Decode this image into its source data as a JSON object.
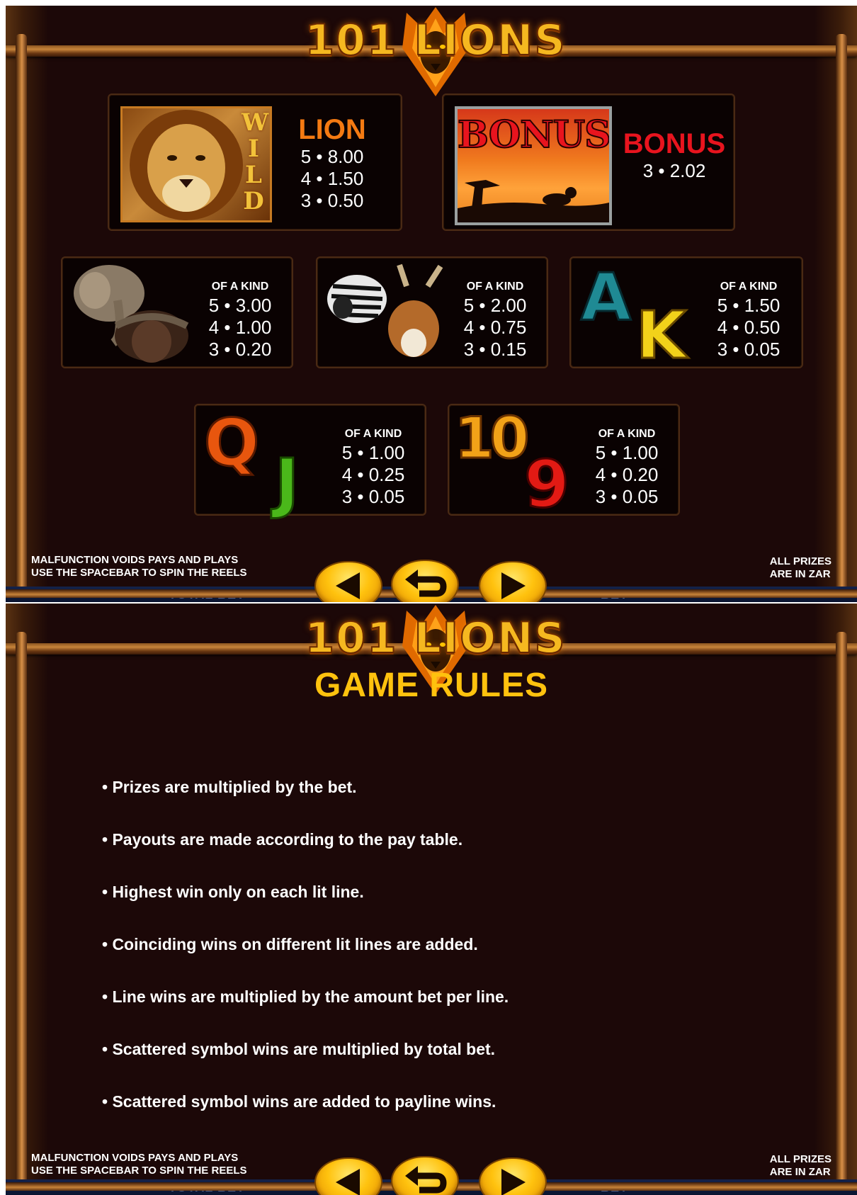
{
  "logo": {
    "text": "101 LIONS"
  },
  "paytable": {
    "lion": {
      "wild_label": "WILD",
      "title": "LION",
      "pays": [
        "5 • 8.00",
        "4 • 1.50",
        "3 • 0.50"
      ]
    },
    "bonus": {
      "art_label": "BONUS",
      "title": "BONUS",
      "pays": [
        "3 • 2.02"
      ]
    },
    "of_a_kind": "OF A KIND",
    "groups": [
      {
        "symbols": [
          "elephant",
          "buffalo"
        ],
        "pays": [
          "5 • 3.00",
          "4 • 1.00",
          "3 • 0.20"
        ]
      },
      {
        "symbols": [
          "zebra",
          "antelope"
        ],
        "pays": [
          "5 • 2.00",
          "4 • 0.75",
          "3 • 0.15"
        ]
      },
      {
        "symbols": [
          "A",
          "K"
        ],
        "pays": [
          "5 • 1.50",
          "4 • 0.50",
          "3 • 0.05"
        ]
      },
      {
        "symbols": [
          "Q",
          "J"
        ],
        "pays": [
          "5 • 1.00",
          "4 • 0.25",
          "3 • 0.05"
        ]
      },
      {
        "symbols": [
          "10",
          "9"
        ],
        "pays": [
          "5 • 1.00",
          "4 • 0.20",
          "3 • 0.05"
        ]
      }
    ]
  },
  "rules": {
    "title": "GAME RULES",
    "items": [
      "• Prizes are multiplied by the bet.",
      "• Payouts are made according to the pay table.",
      "• Highest win only on each lit line.",
      "• Coinciding wins on different lit lines are added.",
      "• Line wins are multiplied by the amount bet per line.",
      "• Scattered symbol wins are multiplied by total bet.",
      "• Scattered symbol wins are added to payline wins."
    ]
  },
  "footer": {
    "left_line1": "MALFUNCTION VOIDS PAYS AND PLAYS",
    "left_line2": "USE THE SPACEBAR TO SPIN THE REELS",
    "right_line1": "ALL PRIZES",
    "right_line2": "ARE IN ZAR"
  },
  "background_labels": {
    "total_bet": "TOTAL BET",
    "bet": "BET"
  },
  "nav": {
    "prev_icon": "left-triangle-icon",
    "back_icon": "return-arrow-icon",
    "next_icon": "right-triangle-icon"
  },
  "colors": {
    "accent_orange": "#f47a12",
    "bonus_red": "#e8141e",
    "title_yellow": "#ffc20e",
    "button_yellow": "#ffc20e"
  }
}
